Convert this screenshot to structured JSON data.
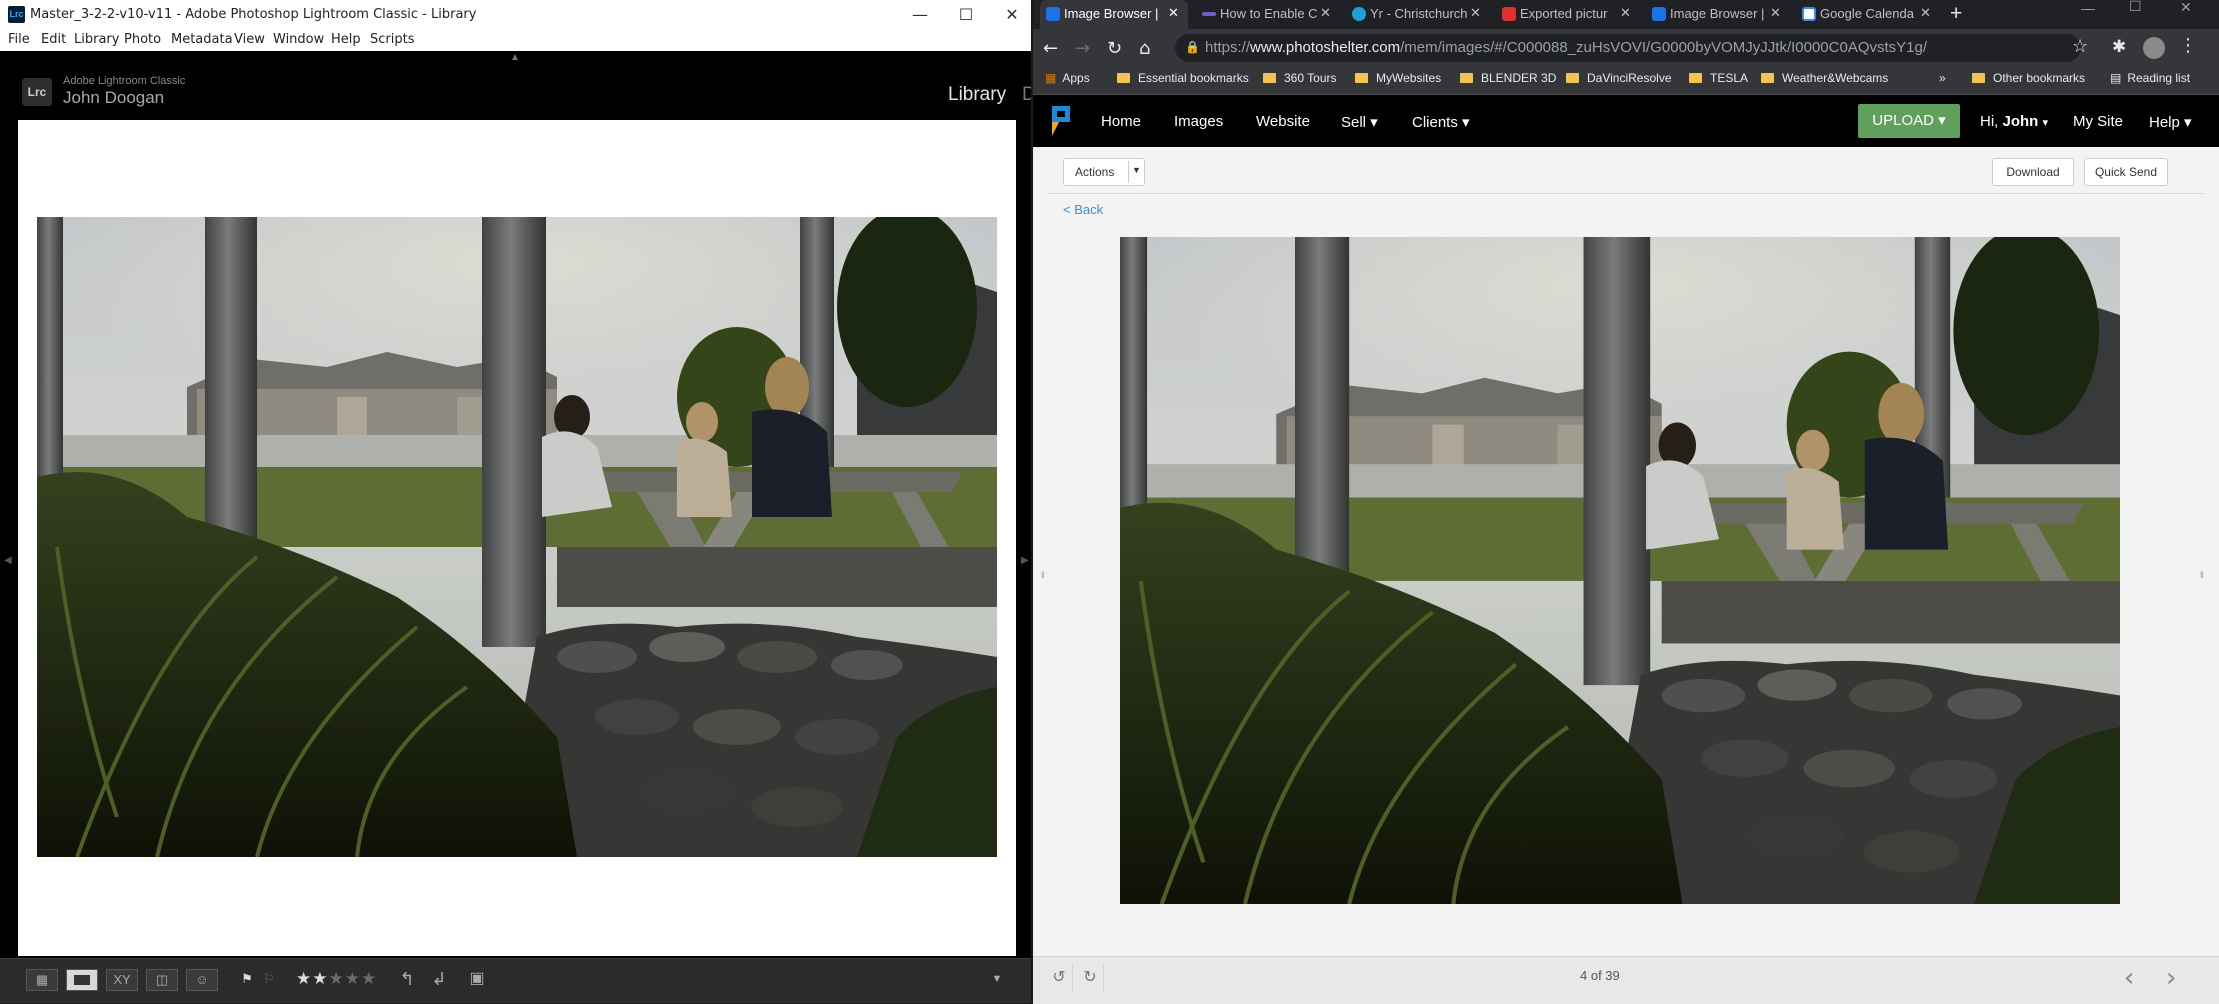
{
  "lightroom": {
    "title": "Master_3-2-2-v10-v11 - Adobe Photoshop Lightroom Classic - Library",
    "app_icon": "Lrc",
    "menu": [
      "File",
      "Edit",
      "Library",
      "Photo",
      "Metadata",
      "View",
      "Window",
      "Help",
      "Scripts"
    ],
    "identity_app": "Adobe Lightroom Classic",
    "identity_user": "John Doogan",
    "module": "Library",
    "module_next": "D",
    "toolbar_views": [
      "grid-view-icon",
      "loupe-view-icon",
      "compare-view-icon",
      "survey-view-icon",
      "people-view-icon"
    ],
    "compare_label": "XY",
    "rating_stars": 2,
    "rating_max": 5
  },
  "browser": {
    "tabs": [
      {
        "title": "Image Browser |",
        "icon": "photoshelter-icon",
        "active": true
      },
      {
        "title": "How to Enable C",
        "icon": "generic-icon",
        "active": false
      },
      {
        "title": "Yr - Christchurch",
        "icon": "yr-icon",
        "active": false
      },
      {
        "title": "Exported pictur",
        "icon": "adobe-icon",
        "active": false
      },
      {
        "title": "Image Browser |",
        "icon": "photoshelter-icon",
        "active": false
      },
      {
        "title": "Google Calenda",
        "icon": "google-calendar-icon",
        "active": false
      }
    ],
    "url_prefix": "https://",
    "url_domain": "www.photoshelter.com",
    "url_path": "/mem/images/#/C000088_zuHsVOVI/G0000byVOMJyJJtk/I0000C0AQvstsY1g/",
    "bookmarks": [
      "Apps",
      "Essential bookmarks",
      "360 Tours",
      "MyWebsites",
      "BLENDER 3D",
      "DaVinciResolve",
      "TESLA",
      "Weather&Webcams"
    ],
    "overflow": "»",
    "other_bookmarks": "Other bookmarks",
    "reading_list": "Reading list"
  },
  "photoshelter": {
    "nav": [
      "Home",
      "Images",
      "Website",
      "Sell ▾",
      "Clients ▾"
    ],
    "upload": "UPLOAD ▾",
    "greeting": "Hi, ",
    "user": "John",
    "greeting_caret": "▾",
    "my_site": "My Site",
    "help": "Help ▾",
    "actions": "Actions",
    "download": "Download",
    "quick_send": "Quick Send",
    "back": "< Back",
    "pager": "4 of 39"
  }
}
